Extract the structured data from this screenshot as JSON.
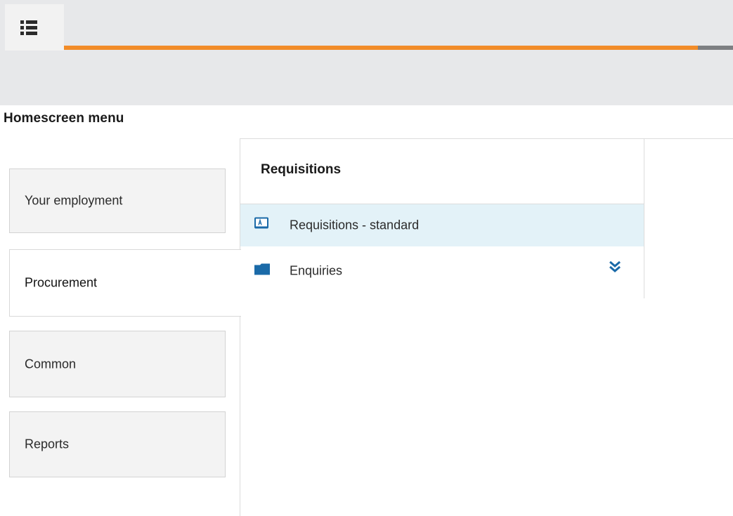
{
  "header": {
    "menu_icon": "list-menu-icon",
    "accent_color": "#f28c28",
    "background_color": "#e7e8ea"
  },
  "page": {
    "title": "Homescreen menu"
  },
  "tabs": [
    {
      "label": "Your employment",
      "active": false
    },
    {
      "label": "Procurement",
      "active": true
    },
    {
      "label": "Common",
      "active": false
    },
    {
      "label": "Reports",
      "active": false
    }
  ],
  "content": {
    "heading": "Requisitions",
    "items": [
      {
        "label": "Requisitions - standard",
        "icon": "form-icon",
        "selected": true
      },
      {
        "label": "Enquiries",
        "icon": "folder-icon",
        "selected": false,
        "expand_icon": "double-chevron-down-icon"
      }
    ],
    "selected_color": "#e3f2f8",
    "icon_color": "#1a6aa8"
  }
}
